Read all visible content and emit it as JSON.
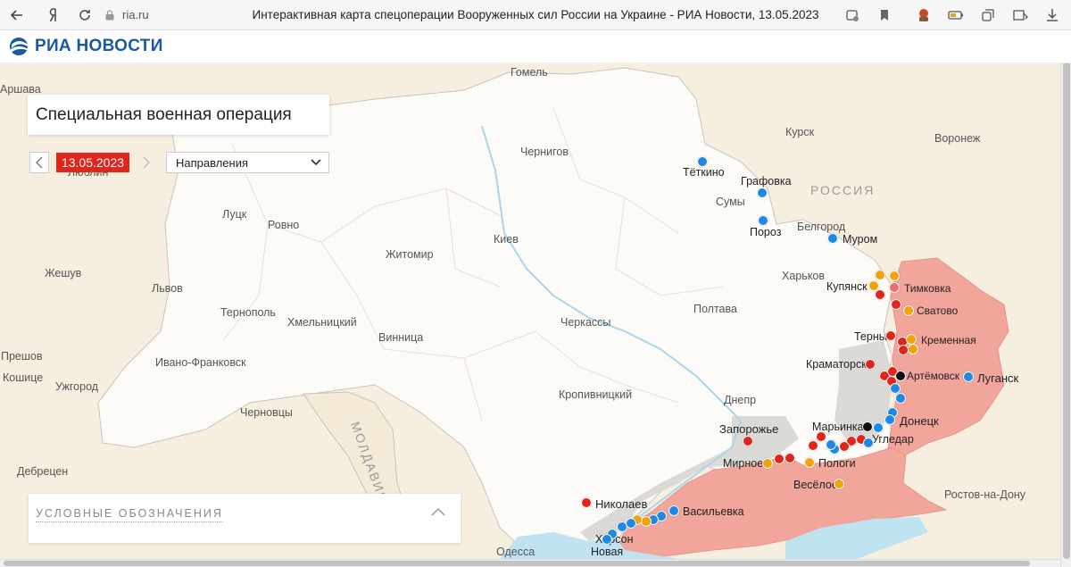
{
  "browser": {
    "url": "ria.ru",
    "page_title": "Интерактивная карта спецоперации Вооруженных сил России на Украине - РИА Новости, 13.05.2023"
  },
  "site": {
    "logo": "РИА НОВОСТИ"
  },
  "panel": {
    "title": "Специальная военная операция",
    "date": "13.05.2023",
    "direction_select": "Направления"
  },
  "legend": {
    "title": "УСЛОВНЫЕ ОБОЗНАЧЕНИЯ"
  },
  "colors": {
    "red": "#e1251b",
    "blue": "#1e88e5",
    "orange": "#f0a30a",
    "pink": "#f26b6b",
    "black": "#111111",
    "controlled_area": "#f2a59b",
    "grey_area": "#dcdad7",
    "sea": "#bfe3f1"
  },
  "map": {
    "country_labels": [
      "РОССИЯ",
      "МОЛДАВИЯ"
    ],
    "cities": [
      "Гомель",
      "Курск",
      "Воронеж",
      "Чернигов",
      "Тёткино",
      "Графовка",
      "Сумы",
      "Пороз",
      "Белгород",
      "Муром",
      "Луцк",
      "Ровно",
      "Житомир",
      "Киев",
      "Жешув",
      "Львов",
      "Харьков",
      "Купянск",
      "Тимковка",
      "Сватово",
      "Тернополь",
      "Хмельницкий",
      "Полтава",
      "Черкассы",
      "Терны",
      "Кременная",
      "Винница",
      "Ивано-Франковск",
      "Краматорск",
      "Артёмовск",
      "Луганск",
      "Кропивницкий",
      "Днепр",
      "Ужгород",
      "Черновцы",
      "Марьинка",
      "Донецк",
      "Запорожье",
      "Угледар",
      "Мирное",
      "Пологи",
      "Дебрецен",
      "Весёлое",
      "Ростов-на-Дону",
      "Николаев",
      "Васильевка",
      "Херсон",
      "Одесса",
      "Новая",
      "Прешов",
      "Кошице",
      "Люблин",
      "Аршава"
    ],
    "partial_labels": [
      "Одесса"
    ]
  }
}
